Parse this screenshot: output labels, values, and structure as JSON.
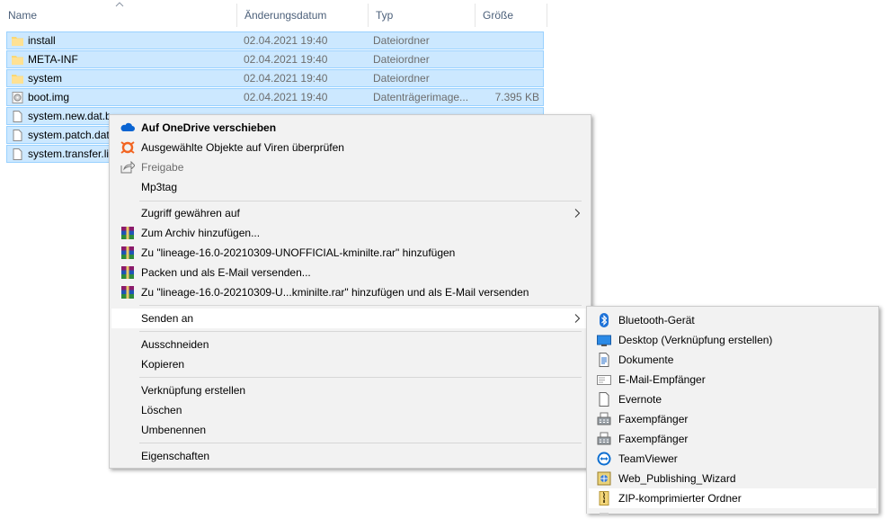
{
  "columns": {
    "name": "Name",
    "date": "Änderungsdatum",
    "type": "Typ",
    "size": "Größe"
  },
  "files": [
    {
      "name": "install",
      "date": "02.04.2021 19:40",
      "type": "Dateiordner",
      "size": "",
      "icon": "folder-icon"
    },
    {
      "name": "META-INF",
      "date": "02.04.2021 19:40",
      "type": "Dateiordner",
      "size": "",
      "icon": "folder-icon"
    },
    {
      "name": "system",
      "date": "02.04.2021 19:40",
      "type": "Dateiordner",
      "size": "",
      "icon": "folder-icon"
    },
    {
      "name": "boot.img",
      "date": "02.04.2021 19:40",
      "type": "Datenträgerimage...",
      "size": "7.395 KB",
      "icon": "disk-image-icon"
    },
    {
      "name": "system.new.dat.b",
      "date": "",
      "type": "",
      "size": "",
      "icon": "file-icon"
    },
    {
      "name": "system.patch.dat",
      "date": "",
      "type": "",
      "size": "",
      "icon": "file-icon"
    },
    {
      "name": "system.transfer.li",
      "date": "",
      "type": "",
      "size": "",
      "icon": "file-icon"
    }
  ],
  "context_menu": {
    "onedrive": "Auf OneDrive verschieben",
    "virus_scan": "Ausgewählte Objekte auf Viren überprüfen",
    "share": "Freigabe",
    "mp3tag": "Mp3tag",
    "grant_access": "Zugriff gewähren auf",
    "add_archive": "Zum Archiv hinzufügen...",
    "add_rar": "Zu \"lineage-16.0-20210309-UNOFFICIAL-kminilte.rar\" hinzufügen",
    "pack_email": "Packen und als E-Mail versenden...",
    "add_rar_email": "Zu \"lineage-16.0-20210309-U...kminilte.rar\" hinzufügen und als E-Mail versenden",
    "send_to": "Senden an",
    "cut": "Ausschneiden",
    "copy": "Kopieren",
    "create_shortcut": "Verknüpfung erstellen",
    "delete": "Löschen",
    "rename": "Umbenennen",
    "properties": "Eigenschaften"
  },
  "send_to_menu": [
    {
      "label": "Bluetooth-Gerät",
      "icon": "bluetooth-icon"
    },
    {
      "label": "Desktop (Verknüpfung erstellen)",
      "icon": "desktop-icon"
    },
    {
      "label": "Dokumente",
      "icon": "documents-icon"
    },
    {
      "label": "E-Mail-Empfänger",
      "icon": "mail-icon"
    },
    {
      "label": "Evernote",
      "icon": "evernote-icon"
    },
    {
      "label": "Faxempfänger",
      "icon": "fax-icon"
    },
    {
      "label": "Faxempfänger",
      "icon": "fax-icon"
    },
    {
      "label": "TeamViewer",
      "icon": "teamviewer-icon"
    },
    {
      "label": "Web_Publishing_Wizard",
      "icon": "web-publishing-icon"
    },
    {
      "label": "ZIP-komprimierter Ordner",
      "icon": "zip-folder-icon"
    }
  ],
  "colors": {
    "selection": "#cce8ff",
    "selection_border": "#99d1ff",
    "menu_bg": "#f2f2f2",
    "header_text": "#4c607a"
  }
}
